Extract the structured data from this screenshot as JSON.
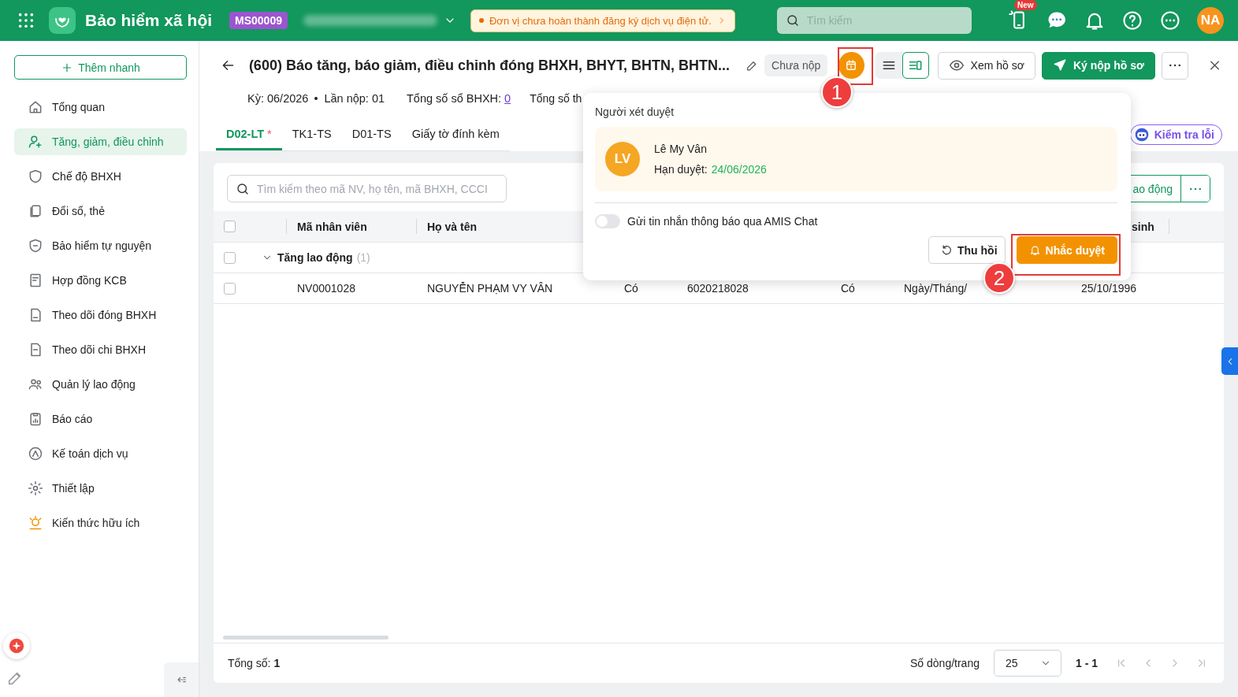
{
  "topbar": {
    "app_title": "Bảo hiểm xã hội",
    "org_code": "MS00009",
    "notice": "Đơn vị chưa hoàn thành đăng ký dịch vụ điện tử.",
    "search": {
      "placeholder": "Tìm kiếm"
    },
    "new_badge": "New",
    "user_initials": "NA"
  },
  "sidebar": {
    "quick_add": "Thêm nhanh",
    "items": [
      {
        "label": "Tổng quan",
        "selected": false
      },
      {
        "label": "Tăng, giảm, điều chỉnh",
        "selected": true
      },
      {
        "label": "Chế độ BHXH",
        "selected": false
      },
      {
        "label": "Đổi sổ, thẻ",
        "selected": false
      },
      {
        "label": "Bảo hiểm tự nguyện",
        "selected": false
      },
      {
        "label": "Hợp đồng KCB",
        "selected": false
      },
      {
        "label": "Theo dõi đóng BHXH",
        "selected": false
      },
      {
        "label": "Theo dõi chi BHXH",
        "selected": false
      },
      {
        "label": "Quản lý lao động",
        "selected": false
      },
      {
        "label": "Báo cáo",
        "selected": false
      },
      {
        "label": "Kế toán dịch vụ",
        "selected": false
      },
      {
        "label": "Thiết lập",
        "selected": false
      },
      {
        "label": "Kiến thức hữu ích",
        "selected": false
      }
    ]
  },
  "document": {
    "title": "(600) Báo tăng, báo giảm, điều chỉnh đóng BHXH, BHYT, BHTN, BHTN...",
    "status": "Chưa nộp",
    "period": "Kỳ: 06/2026",
    "submission": "Lần nộp: 01",
    "book_total_label": "Tổng số sổ BHXH:",
    "book_total": "0",
    "card_total_label": "Tổng số th",
    "view_modes": [
      {
        "selected": false
      },
      {
        "selected": true
      }
    ],
    "view_button": "Xem hồ sơ",
    "submit_button": "Ký nộp hồ sơ"
  },
  "tabs": [
    {
      "label": "D02-LT",
      "marker": "*",
      "selected": true
    },
    {
      "label": "TK1-TS",
      "selected": false
    },
    {
      "label": "D01-TS",
      "selected": false
    },
    {
      "label": "Giấy tờ đính kèm",
      "selected": false
    }
  ],
  "check_errors_button": "Kiểm tra lỗi",
  "table": {
    "search": {
      "placeholder": "Tìm kiếm theo mã NV, họ tên, mã BHXH, CCCI"
    },
    "add_button": "ao động",
    "header_checked": false,
    "columns": [
      {
        "label": "Mã nhân viên"
      },
      {
        "label": "Họ và tên"
      },
      {},
      {},
      {},
      {},
      {
        "label": "sinh"
      }
    ],
    "group": {
      "label": "Tăng lao động",
      "count": "(1)",
      "expanded": true,
      "checked": false
    },
    "rows": [
      {
        "checked": false,
        "cells": [
          "NV0001028",
          "NGUYỄN PHẠM VY VÂN",
          "Có",
          "6020218028",
          "Có",
          "Ngày/Tháng/",
          "25/10/1996"
        ]
      }
    ]
  },
  "footer": {
    "total_label": "Tổng số:",
    "total": "1",
    "page_size_label": "Số dòng/trang",
    "page_size": "25",
    "range": "1 - 1"
  },
  "popover": {
    "title": "Người xét duyệt",
    "approver": {
      "initials": "LV",
      "name": "Lê My Vân",
      "deadline_label": "Hạn duyệt:",
      "deadline": "24/06/2026"
    },
    "notify_toggle": {
      "label": "Gửi tin nhắn thông báo qua AMIS Chat",
      "on": false
    },
    "recall_button": "Thu hồi",
    "remind_button": "Nhắc duyệt"
  },
  "annotations": [
    {
      "label": "1"
    },
    {
      "label": "2"
    }
  ]
}
